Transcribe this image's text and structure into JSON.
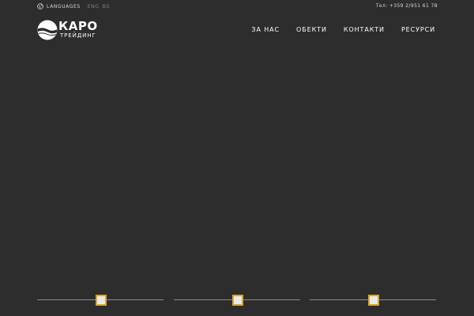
{
  "topbar": {
    "languages_label": "LANGUAGES",
    "language_options": [
      "ENG",
      "BG"
    ],
    "phone": "Тел: +359 2/951 61 78"
  },
  "logo": {
    "name": "КАРО",
    "subtitle": "ТРЕЙДИНГ"
  },
  "nav": {
    "items": [
      "ЗА НАС",
      "ОБЕКТИ",
      "КОНТАКТИ",
      "РЕСУРСИ"
    ]
  },
  "slider": {
    "indicator_count": 3
  },
  "colors": {
    "background": "#2d2d2d",
    "accent": "#d9a828",
    "text": "#ffffff",
    "muted": "#808080"
  },
  "icons": {
    "globe": "globe-icon"
  }
}
